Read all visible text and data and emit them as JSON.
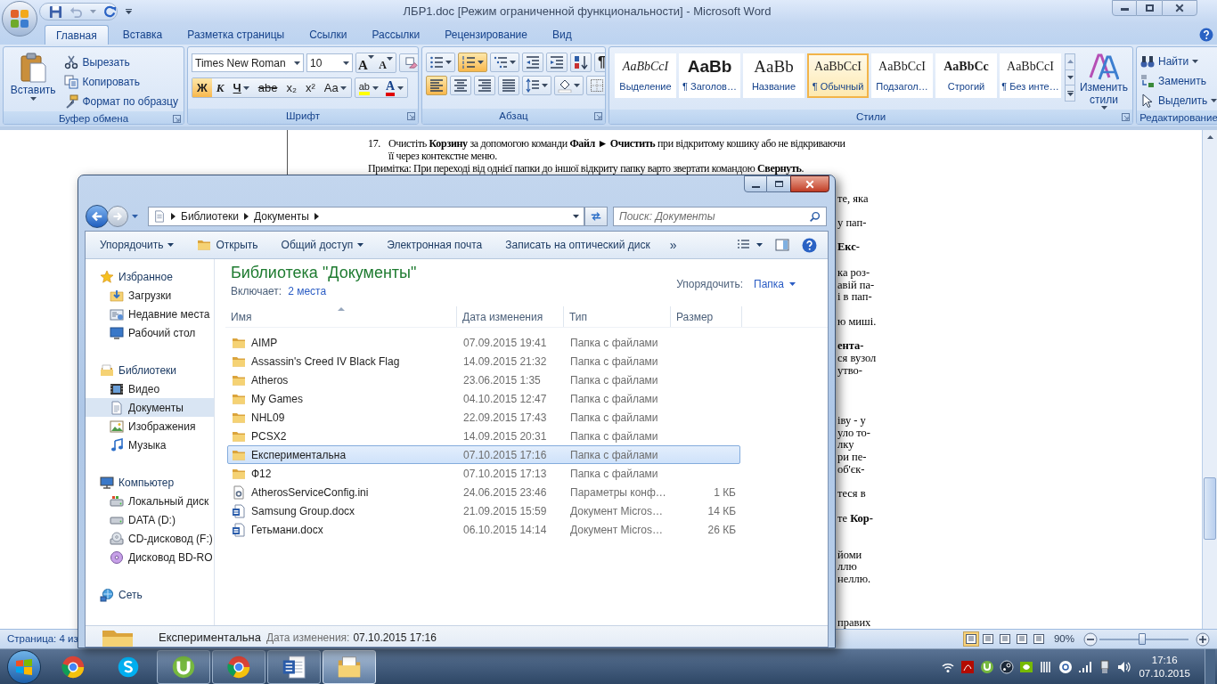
{
  "word": {
    "title": "ЛБР1.doc [Режим ограниченной функциональности] - Microsoft Word",
    "tabs": [
      {
        "label": "Главная",
        "selected": true
      },
      {
        "label": "Вставка",
        "selected": false
      },
      {
        "label": "Разметка страницы",
        "selected": false
      },
      {
        "label": "Ссылки",
        "selected": false
      },
      {
        "label": "Рассылки",
        "selected": false
      },
      {
        "label": "Рецензирование",
        "selected": false
      },
      {
        "label": "Вид",
        "selected": false
      }
    ],
    "clipboard": {
      "label": "Буфер обмена",
      "paste": "Вставить",
      "actions": [
        {
          "label": "Вырезать",
          "kind": "cut"
        },
        {
          "label": "Копировать",
          "kind": "copy"
        },
        {
          "label": "Формат по образцу",
          "kind": "painter"
        }
      ]
    },
    "font": {
      "label": "Шрифт",
      "font_name": "Times New Roman",
      "font_size": "10",
      "size_buttons": [
        "A",
        "A"
      ],
      "format_buttons": [
        {
          "glyph": "Ж",
          "selected": true
        },
        {
          "glyph": "К",
          "selected": false
        },
        {
          "glyph": "Ч",
          "selected": false
        },
        {
          "glyph": "abe",
          "selected": false
        },
        {
          "glyph": "x₂",
          "selected": false
        },
        {
          "glyph": "x²",
          "selected": false
        },
        {
          "glyph": "Aa",
          "selected": false
        }
      ],
      "highlight": "ab",
      "font_color": "A"
    },
    "paragraph": {
      "label": "Абзац",
      "buttons": [
        {
          "kind": "bullets",
          "selected": false
        },
        {
          "kind": "numbering",
          "selected": true
        },
        {
          "kind": "multilevel",
          "selected": false
        },
        {
          "kind": "outdent",
          "selected": false
        },
        {
          "kind": "indent",
          "selected": false
        },
        {
          "kind": "sort",
          "selected": false
        },
        {
          "kind": "pilcrow",
          "glyph": "¶",
          "selected": false
        },
        {
          "kind": "align-left",
          "selected": true
        },
        {
          "kind": "align-center",
          "selected": false
        },
        {
          "kind": "align-right",
          "selected": false
        },
        {
          "kind": "justify",
          "selected": false
        },
        {
          "kind": "line-spacing",
          "selected": false
        },
        {
          "kind": "shading",
          "selected": false
        },
        {
          "kind": "borders",
          "selected": false
        }
      ]
    },
    "styles": {
      "label": "Стили",
      "items": [
        {
          "sample": "AaBbCcI",
          "label": "Выделение",
          "selected": false
        },
        {
          "sample": "AaBb",
          "label": "¶ Заголов…",
          "selected": false
        },
        {
          "sample": "AaBb",
          "label": "Название",
          "selected": false
        },
        {
          "sample": "AaBbCcI",
          "label": "¶ Обычный",
          "selected": true
        },
        {
          "sample": "AaBbCcI",
          "label": "Подзагол…",
          "selected": false
        },
        {
          "sample": "AaBbCc",
          "label": "Строгий",
          "selected": false
        },
        {
          "sample": "AaBbCcI",
          "label": "¶ Без инте…",
          "selected": false
        }
      ],
      "change": "Изменить стили"
    },
    "editing": {
      "label": "Редактирование",
      "actions": [
        {
          "label": "Найти",
          "kind": "find"
        },
        {
          "label": "Заменить",
          "kind": "replace"
        },
        {
          "label": "Выделить",
          "kind": "select"
        }
      ]
    },
    "document": {
      "number": "17.",
      "line": "Очистіть **Корзину** за допомогою команди **Файл ► Очистить** при відкритому кошику або не відкриваючи",
      "continuation": "її через контекстне меню.",
      "note": "Примітка: При переході від однієї папки до іншої відкриту папку варто звертати командою **Свернуть**.",
      "fragments": [
        {
          "text": "те, яка",
          "bold": false
        },
        {
          "text": "у пап-",
          "bold": false
        },
        {
          "text": "Екс-",
          "bold": true
        },
        {
          "text": "ка роз-",
          "bold": false
        },
        {
          "text": "авій па-",
          "bold": false
        },
        {
          "text": "і в пап-",
          "bold": false
        },
        {
          "text": "ю миші.",
          "bold": false
        },
        {
          "text": "ента-",
          "bold": true
        },
        {
          "text": "ся вузол",
          "bold": false
        },
        {
          "text": "утво-",
          "bold": false
        },
        {
          "text": "іву - у",
          "bold": false
        },
        {
          "text": "уло то-",
          "bold": false
        },
        {
          "text": "лку",
          "bold": false
        },
        {
          "text": "ри пе-",
          "bold": false
        },
        {
          "text": "об'єк-",
          "bold": false
        },
        {
          "text": "теся в",
          "bold": false
        },
        {
          "text": "те **Кор-**",
          "bold": false
        },
        {
          "text": "йоми",
          "bold": false
        },
        {
          "text": "ллю",
          "bold": false
        },
        {
          "text": "неллю.",
          "bold": false
        },
        {
          "text": "правих",
          "bold": false
        }
      ]
    },
    "status": {
      "page": "Страница: 4 из",
      "zoom": "90%",
      "zoom_level": {
        "level": 0.48
      }
    }
  },
  "explorer": {
    "breadcrumbs": [
      "Библиотеки",
      "Документы"
    ],
    "search": {
      "placeholder": "Поиск: Документы"
    },
    "toolbar": [
      {
        "label": "Упорядочить",
        "kind": "menu"
      },
      {
        "label": "Открыть",
        "kind": "open"
      },
      {
        "label": "Общий доступ",
        "kind": "menu"
      },
      {
        "label": "Электронная почта",
        "kind": "plain"
      },
      {
        "label": "Записать на оптический диск",
        "kind": "plain"
      }
    ],
    "more": "»",
    "sidebar": [
      {
        "label": "Избранное",
        "kind": "star",
        "selected": false,
        "children": [
          {
            "label": "Загрузки",
            "kind": "downloads",
            "selected": false
          },
          {
            "label": "Недавние места",
            "kind": "recent",
            "selected": false
          },
          {
            "label": "Рабочий стол",
            "kind": "desktop",
            "selected": false
          }
        ]
      },
      {
        "label": "Библиотеки",
        "kind": "library",
        "selected": false,
        "children": [
          {
            "label": "Видео",
            "kind": "video",
            "selected": false
          },
          {
            "label": "Документы",
            "kind": "documents",
            "selected": true
          },
          {
            "label": "Изображения",
            "kind": "pictures",
            "selected": false
          },
          {
            "label": "Музыка",
            "kind": "music",
            "selected": false
          }
        ]
      },
      {
        "label": "Компьютер",
        "kind": "computer",
        "selected": false,
        "children": [
          {
            "label": "Локальный диск",
            "kind": "disk",
            "selected": false
          },
          {
            "label": "DATA (D:)",
            "kind": "drive",
            "selected": false
          },
          {
            "label": "CD-дисковод (F:)",
            "kind": "cd",
            "selected": false
          },
          {
            "label": "Дисковод BD-RO",
            "kind": "bd",
            "selected": false
          }
        ]
      },
      {
        "label": "Сеть",
        "kind": "network",
        "selected": false
      }
    ],
    "title": "Библиотека \"Документы\"",
    "includes_label": "Включает:",
    "includes_link": "2 места",
    "arrange_label": "Упорядочить:",
    "arrange_value": "Папка",
    "columns": [
      "Имя",
      "Дата изменения",
      "Тип",
      "Размер"
    ],
    "rows": [
      {
        "name": "AIMP",
        "date": "07.09.2015 19:41",
        "type": "Папка с файлами",
        "kind": "folder",
        "selected": false
      },
      {
        "name": "Assassin's Creed IV Black Flag",
        "date": "14.09.2015 21:32",
        "type": "Папка с файлами",
        "kind": "folder",
        "selected": false
      },
      {
        "name": "Atheros",
        "date": "23.06.2015 1:35",
        "type": "Папка с файлами",
        "kind": "folder",
        "selected": false
      },
      {
        "name": "My Games",
        "date": "04.10.2015 12:47",
        "type": "Папка с файлами",
        "kind": "folder",
        "selected": false
      },
      {
        "name": "NHL09",
        "date": "22.09.2015 17:43",
        "type": "Папка с файлами",
        "kind": "folder",
        "selected": false
      },
      {
        "name": "PCSX2",
        "date": "14.09.2015 20:31",
        "type": "Папка с файлами",
        "kind": "folder",
        "selected": false
      },
      {
        "name": "Експериментальна",
        "date": "07.10.2015 17:16",
        "type": "Папка с файлами",
        "kind": "folder",
        "selected": true
      },
      {
        "name": "Ф12",
        "date": "07.10.2015 17:13",
        "type": "Папка с файлами",
        "kind": "folder",
        "selected": false
      },
      {
        "name": "AtherosServiceConfig.ini",
        "date": "24.06.2015 23:46",
        "type": "Параметры конф…",
        "size": "1 КБ",
        "kind": "settings",
        "selected": false
      },
      {
        "name": "Samsung Group.docx",
        "date": "21.09.2015 15:59",
        "type": "Документ Micros…",
        "size": "14 КБ",
        "kind": "document",
        "selected": false
      },
      {
        "name": "Гетьмани.docx",
        "date": "06.10.2015 14:14",
        "type": "Документ Micros…",
        "size": "26 КБ",
        "kind": "document",
        "selected": false
      }
    ],
    "details": {
      "name": "Експериментальна",
      "label": "Дата изменения:",
      "value": "07.10.2015 17:16"
    }
  },
  "taskbar": {
    "apps": [
      {
        "kind": "chrome",
        "running": false,
        "active": false
      },
      {
        "kind": "skype",
        "running": false,
        "active": false
      },
      {
        "kind": "torrent",
        "running": true,
        "active": false
      },
      {
        "kind": "chrome",
        "running": true,
        "active": false
      },
      {
        "kind": "word",
        "running": true,
        "active": false
      },
      {
        "kind": "explorer",
        "running": true,
        "active": true
      }
    ],
    "time": "17:16",
    "date": "07.10.2015"
  }
}
